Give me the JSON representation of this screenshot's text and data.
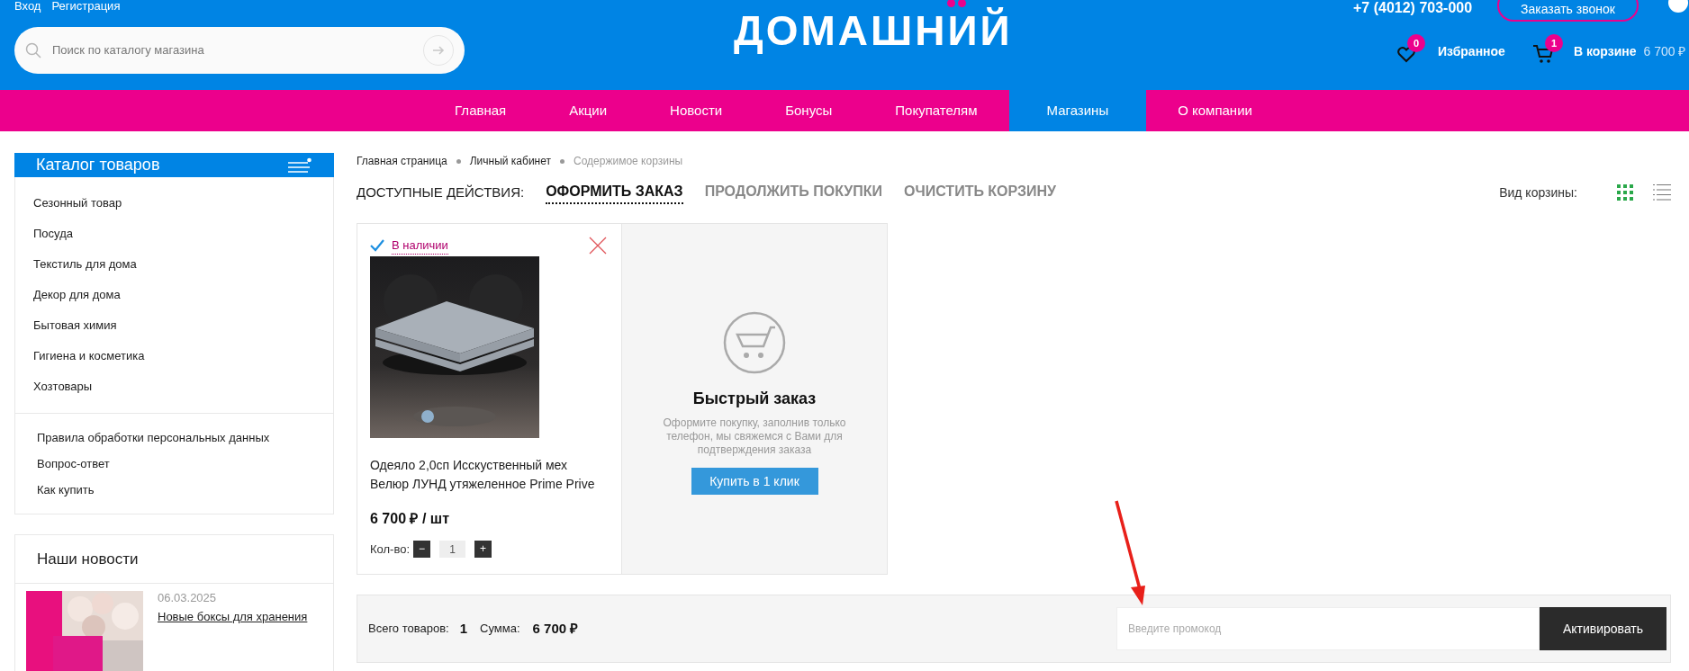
{
  "header": {
    "auth_links": [
      "Вход",
      "Регистрация"
    ],
    "search": {
      "placeholder": "Поиск по каталогу магазина"
    },
    "logo": "ДОМАШНИЙ",
    "phone": "+7 (4012) 703-000",
    "callback_button": "Заказать звонок",
    "favorites": {
      "label": "Избранное",
      "count": "0"
    },
    "cart": {
      "label": "В корзине",
      "count": "1",
      "total": "6 700 ₽"
    }
  },
  "nav": [
    {
      "label": "Главная",
      "selected": false
    },
    {
      "label": "Акции",
      "selected": false
    },
    {
      "label": "Новости",
      "selected": false
    },
    {
      "label": "Бонусы",
      "selected": false
    },
    {
      "label": "Покупателям",
      "selected": false
    },
    {
      "label": "Магазины",
      "selected": true
    },
    {
      "label": "О компании",
      "selected": false
    }
  ],
  "sidebar": {
    "catalog_title": "Каталог товаров",
    "categories": [
      "Сезонный товар",
      "Посуда",
      "Текстиль для дома",
      "Декор для дома",
      "Бытовая химия",
      "Гигиена и косметика",
      "Хозтовары"
    ],
    "info_links": [
      "Правила обработки персональных данных",
      "Вопрос-ответ",
      "Как купить"
    ],
    "news": {
      "title": "Наши новости",
      "items": [
        {
          "date": "06.03.2025",
          "title": "Новые боксы для хранения"
        }
      ]
    }
  },
  "breadcrumbs": [
    {
      "label": "Главная страница",
      "current": false
    },
    {
      "label": "Личный кабинет",
      "current": false
    },
    {
      "label": "Содержимое корзины",
      "current": true
    }
  ],
  "actions": {
    "label": "ДОСТУПНЫЕ ДЕЙСТВИЯ:",
    "items": [
      {
        "label": "ОФОРМИТЬ ЗАКАЗ",
        "selected": true
      },
      {
        "label": "ПРОДОЛЖИТЬ ПОКУПКИ",
        "selected": false
      },
      {
        "label": "ОЧИСТИТЬ КОРЗИНУ",
        "selected": false
      }
    ]
  },
  "view": {
    "label": "Вид корзины:",
    "options": [
      {
        "kind": "grid",
        "selected": true
      },
      {
        "kind": "list",
        "selected": false
      }
    ]
  },
  "cart_items": [
    {
      "availability": "В наличии",
      "name": "Одеяло 2,0сп Исскуственный мех Велюр ЛУНД утяжеленное Prime Prive",
      "price": "6 700 ₽ / шт",
      "qty_label": "Кол-во:",
      "quantity": "1",
      "minus": "−",
      "plus": "+"
    }
  ],
  "quick_order": {
    "title": "Быстрый заказ",
    "text": "Оформите покупку, заполнив только телефон, мы свяжемся с Вами для подтверждения заказа",
    "button": "Купить в 1 клик"
  },
  "summary": {
    "count_label": "Всего товаров:",
    "count": "1",
    "sum_label": "Сумма:",
    "sum": "6 700 ₽",
    "promo_placeholder": "Введите промокод",
    "activate_button": "Активировать"
  }
}
